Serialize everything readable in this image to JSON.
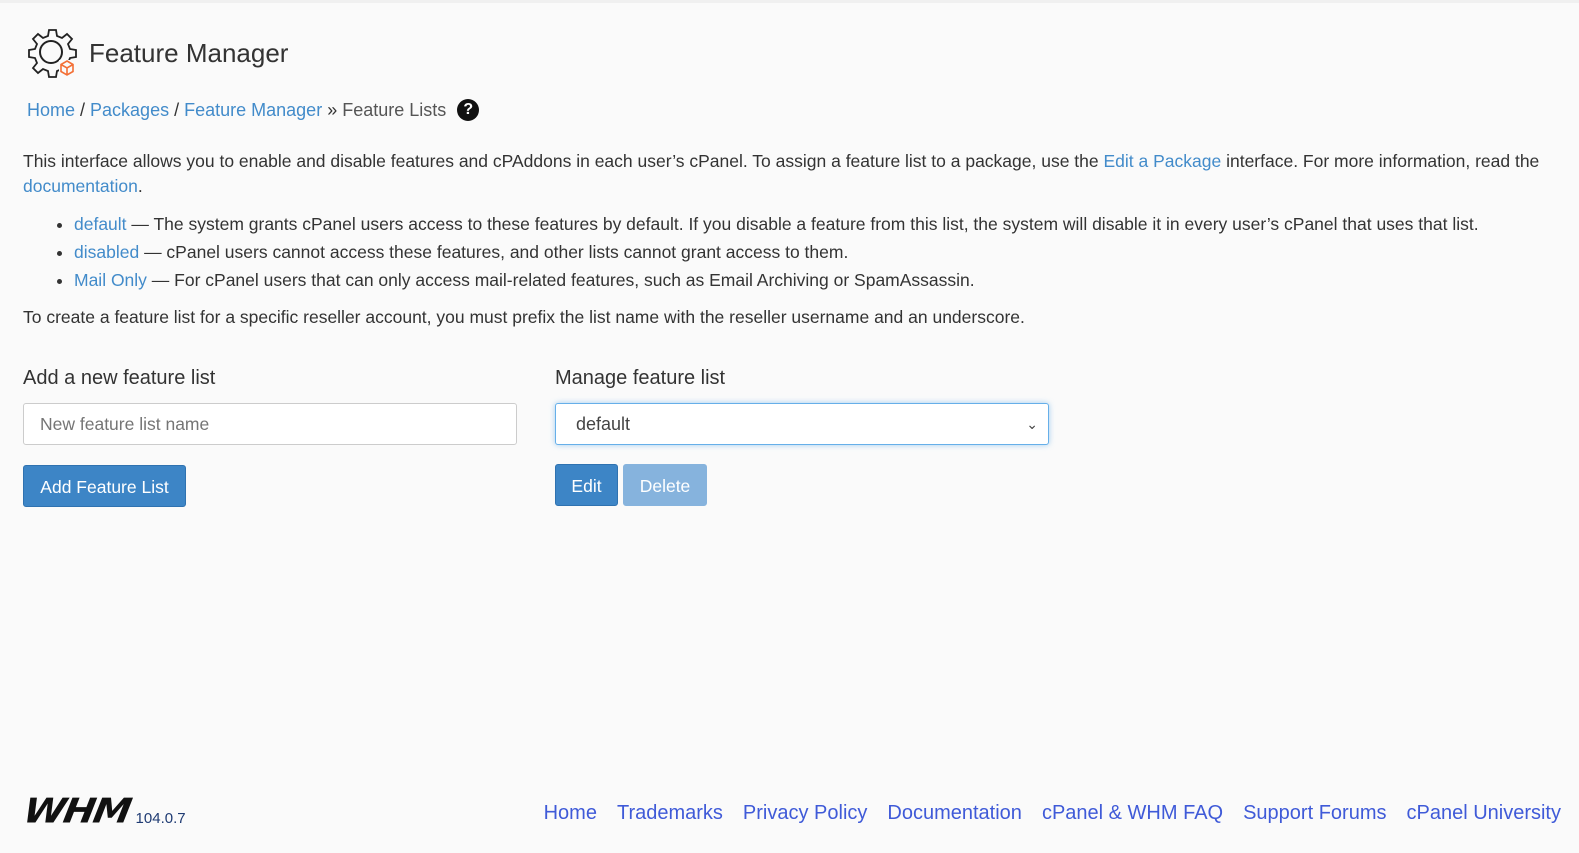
{
  "header": {
    "title": "Feature Manager"
  },
  "breadcrumb": {
    "items": [
      "Home",
      "Packages",
      "Feature Manager"
    ],
    "seps": [
      "/",
      "/",
      "»"
    ],
    "current": "Feature Lists"
  },
  "intro": {
    "text1": "This interface allows you to enable and disable features and cPAddons in each user’s cPanel. To assign a feature list to a package, use the ",
    "link1": "Edit a Package",
    "text2": " interface. For more information, read the ",
    "link2": "documentation",
    "text3": "."
  },
  "lists": [
    {
      "name": "default",
      "desc": " — The system grants cPanel users access to these features by default. If you disable a feature from this list, the system will disable it in every user’s cPanel that uses that list."
    },
    {
      "name": "disabled",
      "desc": " — cPanel users cannot access these features, and other lists cannot grant access to them."
    },
    {
      "name": "Mail Only",
      "desc": " — For cPanel users that can only access mail-related features, such as Email Archiving or SpamAssassin."
    }
  ],
  "reseller_note": "To create a feature list for a specific reseller account, you must prefix the list name with the reseller username and an underscore.",
  "add": {
    "label": "Add a new feature list",
    "placeholder": "New feature list name",
    "button": "Add Feature List"
  },
  "manage": {
    "label": "Manage feature list",
    "selected": "default",
    "edit": "Edit",
    "delete": "Delete"
  },
  "footer": {
    "logo": "WHM",
    "version": "104.0.7",
    "links": [
      "Home",
      "Trademarks",
      "Privacy Policy",
      "Documentation",
      "cPanel & WHM FAQ",
      "Support Forums",
      "cPanel University"
    ]
  }
}
